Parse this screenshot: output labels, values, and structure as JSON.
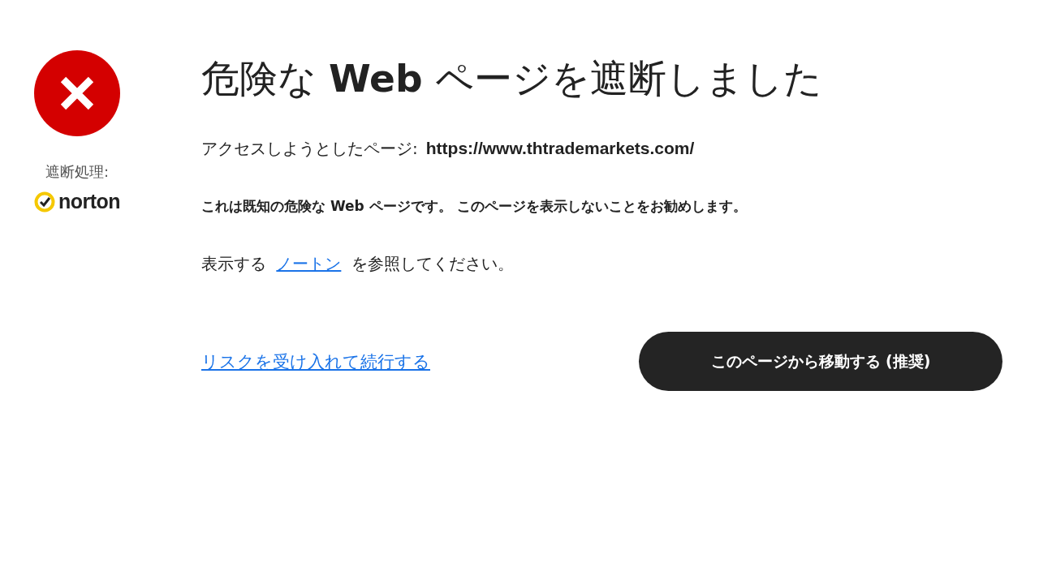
{
  "sidebar": {
    "blocked_by_label": "遮断処理:",
    "brand": "norton"
  },
  "title": "危険な **Web** ページを遮断しました",
  "access": {
    "label": "アクセスしようとしたページ:",
    "url": "https://www.thtrademarkets.com/"
  },
  "warning": "これは既知の危険な Web ページです。 このページを表示しないことをお勧めします。",
  "reference": {
    "before": "表示する",
    "link": "ノートン",
    "after": "を参照してください。"
  },
  "actions": {
    "continue_link": "リスクを受け入れて続行する",
    "leave_button": "このページから移動する (推奨)"
  }
}
